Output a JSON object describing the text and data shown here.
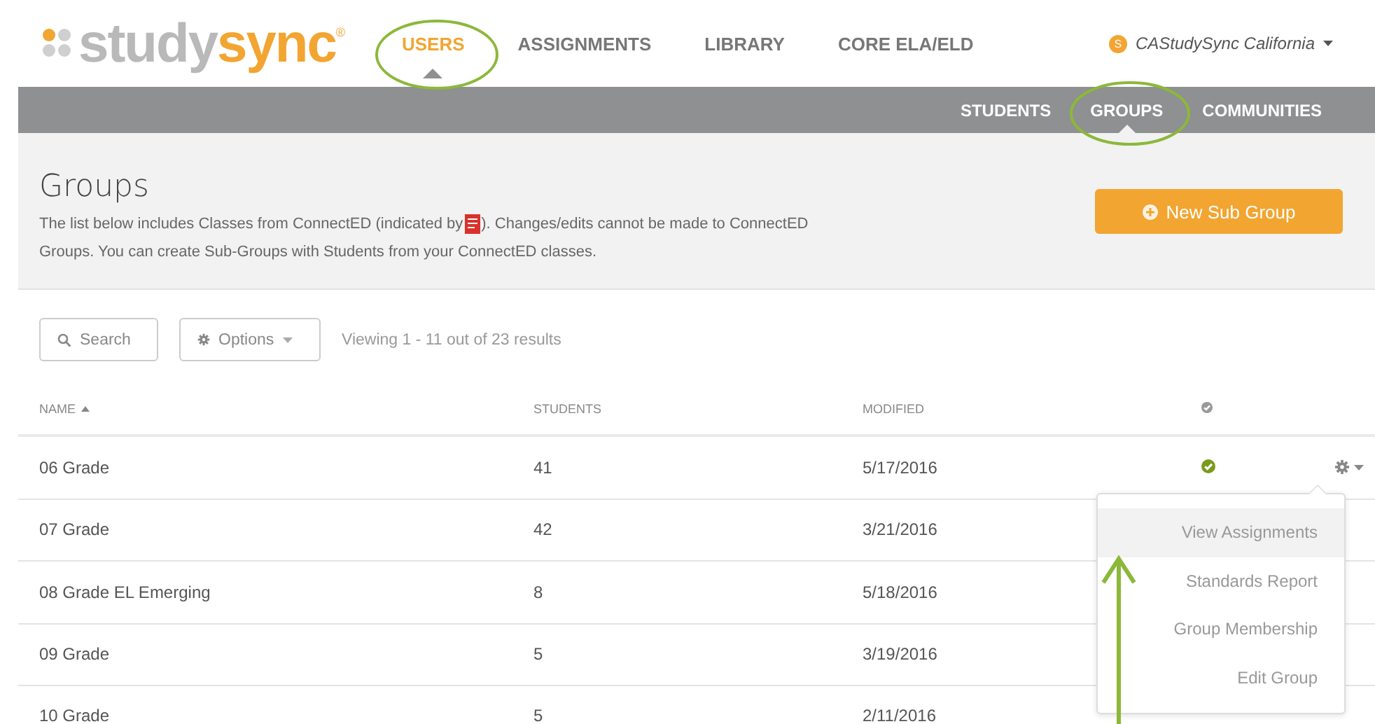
{
  "header": {
    "logo_study": "study",
    "logo_sync": "sync",
    "logo_mark": "®",
    "tabs": [
      {
        "label": "USERS",
        "selected": true
      },
      {
        "label": "ASSIGNMENTS",
        "selected": false
      },
      {
        "label": "LIBRARY",
        "selected": false
      },
      {
        "label": "CORE ELA/ELD",
        "selected": false
      }
    ],
    "account": {
      "badge": "S",
      "name": "CAStudySync California"
    }
  },
  "subnav": [
    {
      "label": "STUDENTS",
      "selected": false
    },
    {
      "label": "GROUPS",
      "selected": true
    },
    {
      "label": "COMMUNITIES",
      "selected": false
    }
  ],
  "intro": {
    "title": "Groups",
    "description_before": "The list below includes Classes from ConnectED (indicated by",
    "description_after": "). Changes/edits cannot be made to ConnectED",
    "description_line2": "Groups. You can create Sub-Groups with Students from your ConnectED classes.",
    "button": "New Sub Group"
  },
  "toolbar": {
    "search": "Search",
    "options": "Options",
    "summary": "Viewing 1 - 11 out of 23 results"
  },
  "table": {
    "columns": [
      "NAME",
      "STUDENTS",
      "MODIFIED"
    ],
    "rows": [
      {
        "name": "06 Grade",
        "students": "41",
        "modified": "5/17/2016",
        "checked": true,
        "menu_open": true
      },
      {
        "name": "07 Grade",
        "students": "42",
        "modified": "3/21/2016"
      },
      {
        "name": "08 Grade EL Emerging",
        "students": "8",
        "modified": "5/18/2016"
      },
      {
        "name": "09 Grade",
        "students": "5",
        "modified": "3/19/2016"
      },
      {
        "name": "10 Grade",
        "students": "5",
        "modified": "2/11/2016"
      }
    ]
  },
  "row_menu": [
    {
      "label": "View Assignments",
      "selected": true
    },
    {
      "label": "Standards Report",
      "selected": false
    },
    {
      "label": "Group Membership",
      "selected": false
    },
    {
      "label": "Edit Group",
      "selected": false
    }
  ]
}
